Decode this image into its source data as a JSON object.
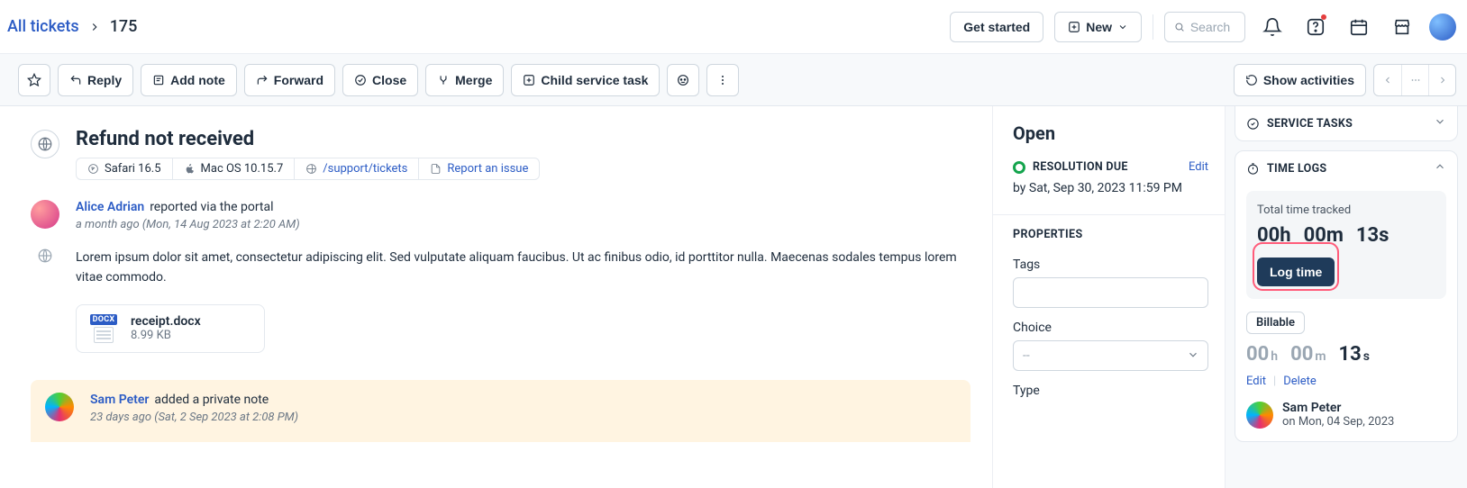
{
  "breadcrumb": {
    "root": "All tickets",
    "current": "175"
  },
  "header": {
    "get_started": "Get started",
    "new": "New",
    "search_placeholder": "Search"
  },
  "actbar": {
    "reply": "Reply",
    "add_note": "Add note",
    "forward": "Forward",
    "close": "Close",
    "merge": "Merge",
    "child_task": "Child service task",
    "show_activities": "Show activities"
  },
  "ticket": {
    "title": "Refund not received",
    "meta": {
      "browser": "Safari 16.5",
      "os": "Mac OS 10.15.7",
      "path": "/support/tickets",
      "report": "Report an issue"
    }
  },
  "msg1": {
    "name": "Alice Adrian",
    "action": "reported via the portal",
    "time": "a month ago (Mon, 14 Aug 2023 at 2:20 AM)",
    "body": "Lorem ipsum dolor sit amet, consectetur adipiscing elit. Sed vulputate aliquam faucibus. Ut ac finibus odio, id porttitor nulla. Maecenas sodales tempus lorem vitae commodo.",
    "attach_name": "receipt.docx",
    "attach_size": "8.99 KB",
    "docx_label": "DOCX"
  },
  "msg2": {
    "name": "Sam Peter",
    "action": "added a private note",
    "time": "23 days ago (Sat, 2 Sep 2023 at 2:08 PM)"
  },
  "side": {
    "status": "Open",
    "res_label": "RESOLUTION DUE",
    "edit": "Edit",
    "due": "by Sat, Sep 30, 2023 11:59 PM",
    "properties": "PROPERTIES",
    "tags_lbl": "Tags",
    "choice_lbl": "Choice",
    "choice_placeholder": "--",
    "type_lbl": "Type"
  },
  "right": {
    "service_tasks": "SERVICE TASKS",
    "time_logs": "TIME LOGS",
    "total_label": "Total time tracked",
    "tt_h": "00h",
    "tt_m": "00m",
    "tt_s": "13s",
    "log_time": "Log time",
    "billable": "Billable",
    "b_h": "00",
    "b_h_u": "h",
    "b_m": "00",
    "b_m_u": "m",
    "b_s": "13",
    "b_s_u": "s",
    "edit": "Edit",
    "delete": "Delete",
    "logger_name": "Sam Peter",
    "logger_date": "on Mon, 04 Sep, 2023"
  }
}
